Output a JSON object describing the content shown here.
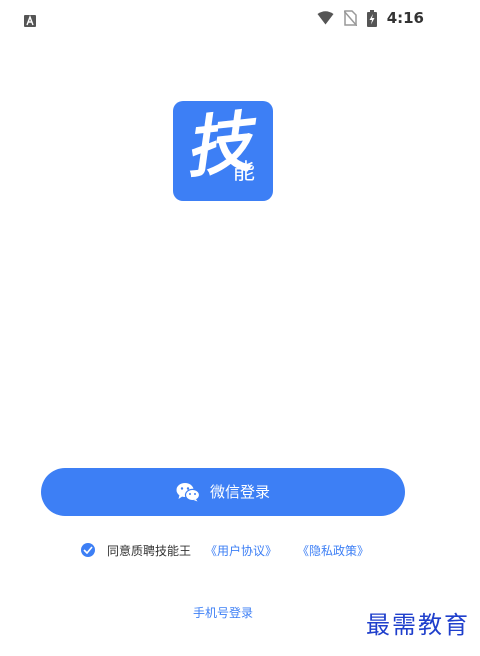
{
  "status_bar": {
    "time": "4:16",
    "notification_icon": "a-icon",
    "wifi_icon": "wifi-icon",
    "signal_icon": "no-sim-icon",
    "battery_icon": "battery-charging-icon"
  },
  "logo": {
    "big_char": "技",
    "small_text": "能"
  },
  "wechat_login": {
    "label": "微信登录",
    "icon": "wechat-icon"
  },
  "agreement": {
    "text": "同意质聘技能王",
    "user_agreement": "《用户协议》",
    "privacy_policy": "《隐私政策》"
  },
  "phone_login": {
    "label": "手机号登录"
  },
  "watermark": {
    "text": "最需教育"
  },
  "colors": {
    "primary": "#3d7ff5",
    "text_dark": "#333333",
    "watermark": "#1f3fcc"
  }
}
